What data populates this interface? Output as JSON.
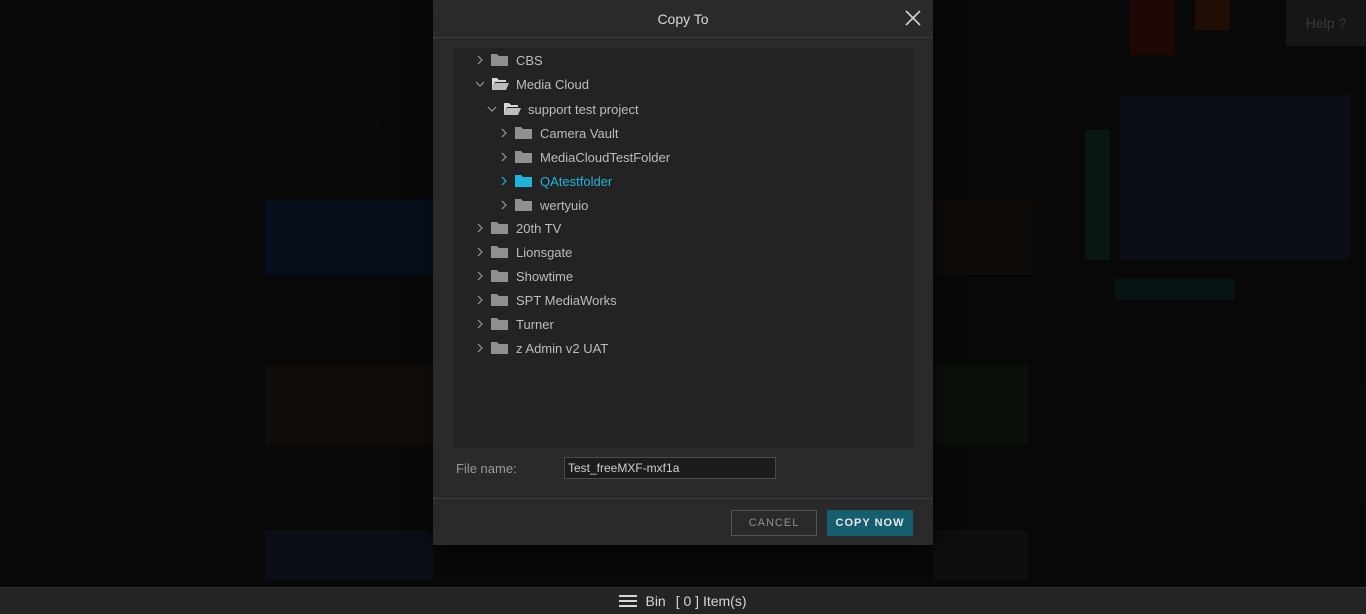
{
  "help": {
    "label": "Help ?"
  },
  "dialog": {
    "title": "Copy To",
    "tree": [
      {
        "label": "CBS",
        "expanded": false,
        "selected": false,
        "open_folder": false
      },
      {
        "label": "Media Cloud",
        "expanded": true,
        "selected": false,
        "open_folder": true
      },
      {
        "label": "support test project",
        "expanded": true,
        "selected": false,
        "open_folder": true
      },
      {
        "label": "Camera Vault",
        "expanded": false,
        "selected": false,
        "open_folder": false
      },
      {
        "label": "MediaCloudTestFolder",
        "expanded": false,
        "selected": false,
        "open_folder": false
      },
      {
        "label": "QAtestfolder",
        "expanded": false,
        "selected": true,
        "open_folder": false
      },
      {
        "label": "wertyuio",
        "expanded": false,
        "selected": false,
        "open_folder": false
      },
      {
        "label": "20th TV",
        "expanded": false,
        "selected": false,
        "open_folder": false
      },
      {
        "label": "Lionsgate",
        "expanded": false,
        "selected": false,
        "open_folder": false
      },
      {
        "label": "Showtime",
        "expanded": false,
        "selected": false,
        "open_folder": false
      },
      {
        "label": "SPT MediaWorks",
        "expanded": false,
        "selected": false,
        "open_folder": false
      },
      {
        "label": "Turner",
        "expanded": false,
        "selected": false,
        "open_folder": false
      },
      {
        "label": "z Admin v2 UAT",
        "expanded": false,
        "selected": false,
        "open_folder": false
      }
    ],
    "file_name_label": "File name:",
    "file_name_value": "Test_freeMXF-mxf1a",
    "cancel_label": "CANCEL",
    "copy_label": "COPY NOW"
  },
  "bottom_bar": {
    "bin_label": "Bin",
    "items_text": "[ 0 ] Item(s)"
  },
  "colors": {
    "accent": "#1fb4dc",
    "primary_button": "#155e6e",
    "folder": "#8f8f8f"
  },
  "icons": [
    "close-icon",
    "chevron-right-icon",
    "chevron-down-icon",
    "folder-icon",
    "folder-open-icon",
    "menu-icon"
  ]
}
